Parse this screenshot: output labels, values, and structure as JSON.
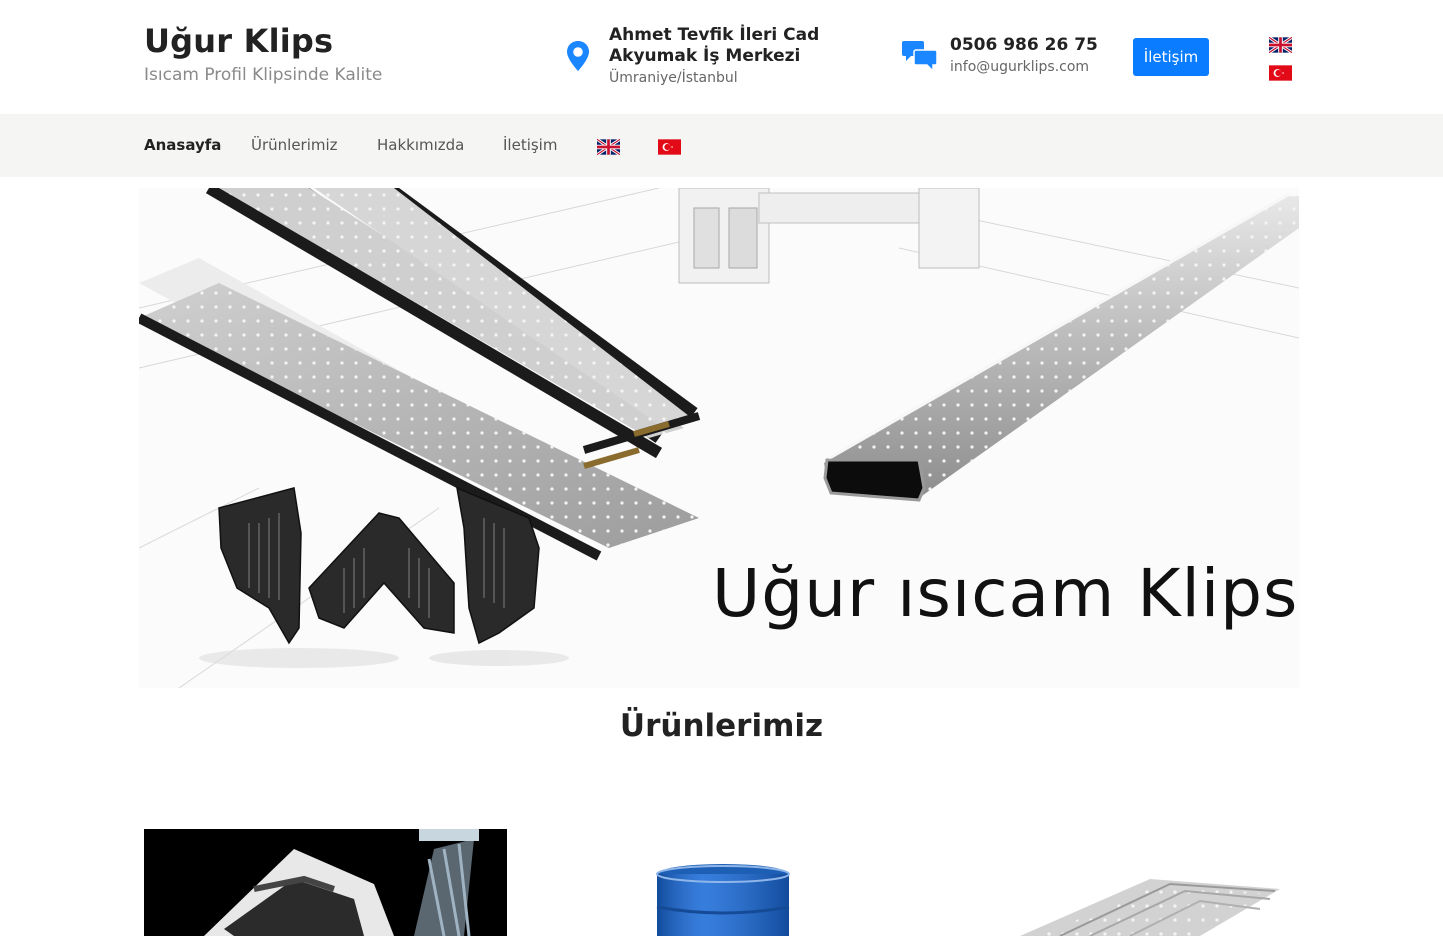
{
  "header": {
    "brand_title": "Uğur Klips",
    "brand_subtitle": "Isıcam Profil Klipsinde Kalite",
    "address": {
      "line1": "Ahmet Tevfik İleri Cad",
      "line2": "Akyumak İş Merkezi",
      "line3": "Ümraniye/İstanbul"
    },
    "phone": "0506 986 26 75",
    "email": "info@ugurklips.com",
    "contact_button": "İletişim",
    "icons": {
      "address": "location-pin-icon",
      "contact": "chat-bubbles-icon",
      "english": "uk-flag-icon",
      "turkish": "turkey-flag-icon"
    }
  },
  "nav": {
    "items": [
      {
        "label": "Anasayfa",
        "active": true
      },
      {
        "label": "Ürünlerimiz",
        "active": false
      },
      {
        "label": "Hakkımızda",
        "active": false
      },
      {
        "label": "İletişim",
        "active": false
      }
    ]
  },
  "hero": {
    "caption": "Uğur ısıcam Klips"
  },
  "products": {
    "title": "Ürünlerimiz"
  },
  "colors": {
    "accent": "#0a7cff",
    "nav_bg": "#f5f6f4"
  }
}
